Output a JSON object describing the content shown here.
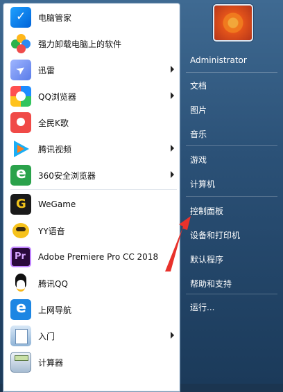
{
  "programs": [
    {
      "label": "电脑管家",
      "icon": "shield-check-icon",
      "arrow": false
    },
    {
      "label": "强力卸载电脑上的软件",
      "icon": "flower-icon",
      "arrow": false
    },
    {
      "label": "迅雷",
      "icon": "xunlei-bird-icon",
      "arrow": true
    },
    {
      "label": "QQ浏览器",
      "icon": "qq-browser-icon",
      "arrow": true
    },
    {
      "label": "全民K歌",
      "icon": "ksong-icon",
      "arrow": false
    },
    {
      "label": "腾讯视频",
      "icon": "tencent-video-icon",
      "arrow": true
    },
    {
      "label": "360安全浏览器",
      "icon": "360-browser-icon",
      "arrow": true
    },
    {
      "label": "WeGame",
      "icon": "wegame-icon",
      "arrow": false
    },
    {
      "label": "YY语音",
      "icon": "yy-voice-icon",
      "arrow": false
    },
    {
      "label": "Adobe Premiere Pro CC 2018",
      "icon": "premiere-pro-icon",
      "arrow": false
    },
    {
      "label": "腾讯QQ",
      "icon": "qq-penguin-icon",
      "arrow": false
    },
    {
      "label": "上网导航",
      "icon": "ie-navigation-icon",
      "arrow": false
    },
    {
      "label": "入门",
      "icon": "getting-started-icon",
      "arrow": true
    },
    {
      "label": "计算器",
      "icon": "calculator-icon",
      "arrow": false
    }
  ],
  "right": {
    "user": "Administrator",
    "items": [
      "文档",
      "图片",
      "音乐",
      "游戏",
      "计算机",
      "控制面板",
      "设备和打印机",
      "默认程序",
      "帮助和支持",
      "运行..."
    ]
  },
  "colors": {
    "annotation_arrow": "#e8322c"
  }
}
